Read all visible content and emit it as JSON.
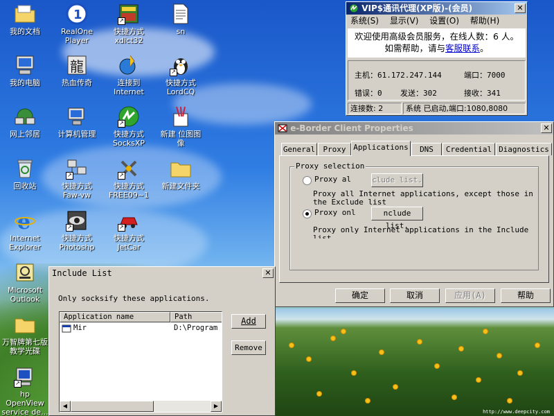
{
  "desktop_icons": [
    {
      "label": "我的文档"
    },
    {
      "label": "RealOne Player"
    },
    {
      "label": "快捷方式 xdict32"
    },
    {
      "label": "sn"
    },
    {
      "label": "我的电脑"
    },
    {
      "label": "热血传奇"
    },
    {
      "label": "连接到 Internet"
    },
    {
      "label": "快捷方式 LordCQ"
    },
    {
      "label": "网上邻居"
    },
    {
      "label": "计算机管理"
    },
    {
      "label": "快捷方式 SocksXP"
    },
    {
      "label": "新建 位图图像"
    },
    {
      "label": "回收站"
    },
    {
      "label": "快捷方式 Faw-vw"
    },
    {
      "label": "快捷方式 FREE09~1"
    },
    {
      "label": "新建文件夹"
    },
    {
      "label": "Internet Explorer"
    },
    {
      "label": "快捷方式 Photoshp"
    },
    {
      "label": "快捷方式 JetCar"
    },
    {
      "label": "Microsoft Outlook"
    },
    {
      "label": "万智牌第七版教学光碟"
    },
    {
      "label": "hp OpenView service de..."
    }
  ],
  "vip_window": {
    "title": "VIP$通讯代理(XP版)-(会员)",
    "menu": [
      "系统(S)",
      "显示(V)",
      "设置(O)",
      "帮助(H)"
    ],
    "welcome_prefix": "欢迎使用高级会员服务，在线人数：6 人。 如需帮助，请与",
    "welcome_link": "客服联系",
    "welcome_suffix": "。",
    "host_label": "主机：",
    "host_value": "61.172.247.144",
    "port_label": "端口：",
    "port_value": "7000",
    "error_label": "错误：",
    "error_value": "0",
    "sent_label": "发送：",
    "sent_value": "302",
    "recv_label": "接收：",
    "recv_value": "341",
    "status_connections": "连接数: 2",
    "status_system": "系统 已启动,端口:1080,8080"
  },
  "eborder_window": {
    "title": "e-Border Client Properties",
    "tabs": [
      "General",
      "Proxy",
      "Applications",
      "DNS",
      "Credential",
      "Diagnostics"
    ],
    "selected_tab": "Applications",
    "group_title": "Proxy selection",
    "radio_all_label": "Proxy al",
    "radio_all_checked": false,
    "exclude_button": "clude list.",
    "exclude_desc": "Proxy all Internet applications, except those in the Exclude list",
    "radio_only_label": "Proxy onl",
    "radio_only_checked": true,
    "include_button": "nclude list.",
    "include_desc": "Proxy only Internet applications in the Include list",
    "ok_button": "确定",
    "cancel_button": "取消",
    "apply_button": "应用(A)",
    "help_button": "帮助"
  },
  "include_window": {
    "title": "Include List",
    "description": "Only socksify these applications.",
    "columns": [
      "Application name",
      "Path"
    ],
    "rows": [
      {
        "name": "Mir",
        "path": "D:\\Program F"
      }
    ],
    "add_button": "Add",
    "remove_button": "Remove"
  },
  "watermark": "http://www.deepcity.com"
}
